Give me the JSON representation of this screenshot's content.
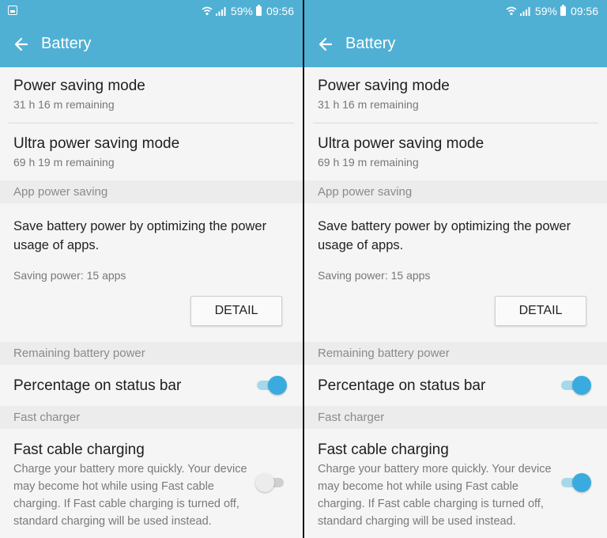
{
  "status": {
    "battery_pct": "59%",
    "time": "09:56"
  },
  "toolbar": {
    "title": "Battery"
  },
  "power_saving": {
    "title": "Power saving mode",
    "sub": "31 h 16 m remaining"
  },
  "ultra_power_saving": {
    "title": "Ultra power saving mode",
    "sub": "69 h 19 m remaining"
  },
  "app_power": {
    "header": "App power saving",
    "desc_line1": "Save battery power by optimizing the power",
    "desc_line2": "usage of apps.",
    "saving": "Saving power: 15 apps",
    "detail_label": "DETAIL"
  },
  "remaining": {
    "header": "Remaining battery power",
    "percentage_label": "Percentage on status bar"
  },
  "fast": {
    "header": "Fast charger",
    "title": "Fast cable charging",
    "desc_lines": [
      "Charge your battery more quickly. Your device",
      "may become hot while using Fast cable",
      "charging. If Fast cable charging is turned off,",
      "standard charging will be used instead."
    ]
  },
  "panels": [
    {
      "percentage_on": true,
      "fast_charging_on": false
    },
    {
      "percentage_on": true,
      "fast_charging_on": true
    }
  ],
  "colors": {
    "header_bg": "#4fb0d4",
    "toggle_on": "#3aabde"
  }
}
